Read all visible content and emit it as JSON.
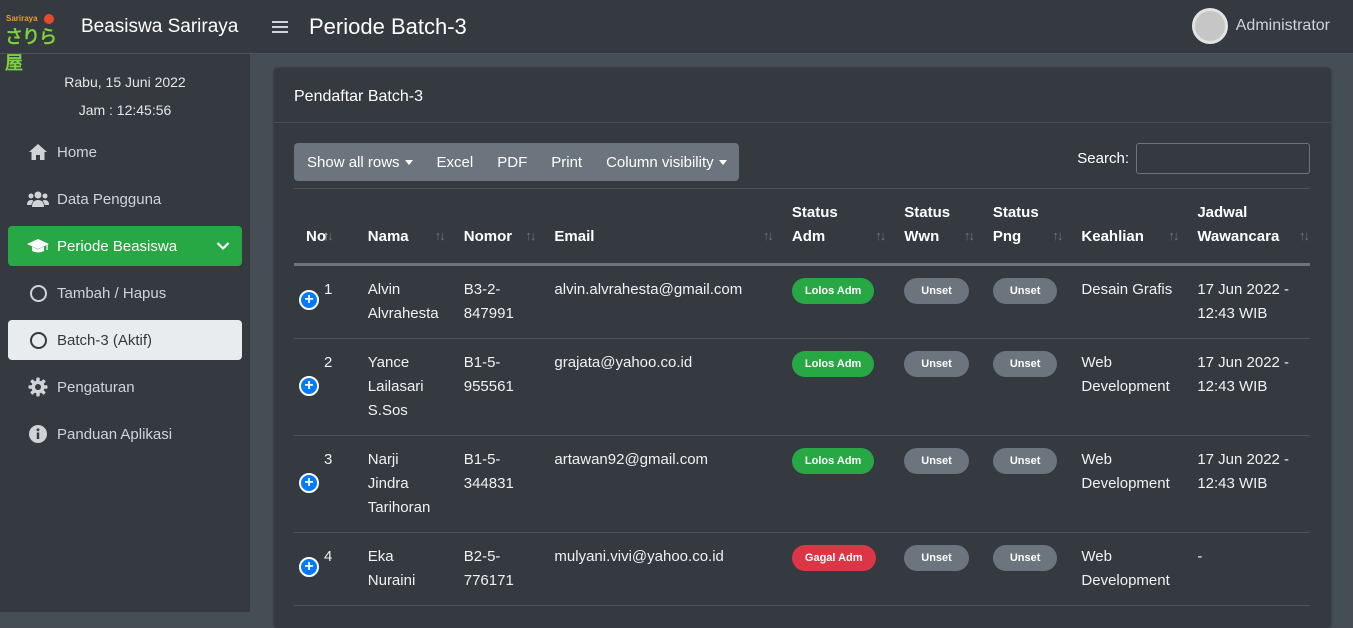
{
  "brand": {
    "logo_small": "Sariraya",
    "logo_big": "さりら屋",
    "name": "Beasiswa Sariraya"
  },
  "datetime": {
    "date": "Rabu, 15 Juni 2022",
    "time": "Jam : 12:45:56"
  },
  "nav": {
    "home": "Home",
    "users": "Data Pengguna",
    "periode": "Periode Beasiswa",
    "tambah": "Tambah / Hapus",
    "batch": "Batch-3 (Aktif)",
    "pengaturan": "Pengaturan",
    "panduan": "Panduan Aplikasi"
  },
  "header": {
    "title": "Periode Batch-3",
    "user": "Administrator"
  },
  "card": {
    "title": "Pendaftar Batch-3"
  },
  "toolbar": {
    "show_rows": "Show all rows",
    "excel": "Excel",
    "pdf": "PDF",
    "print": "Print",
    "colvis": "Column visibility"
  },
  "search": {
    "label": "Search:",
    "value": ""
  },
  "table": {
    "headers": {
      "no": "No",
      "nama": "Nama",
      "nomor": "Nomor",
      "email": "Email",
      "sadm_1": "Status",
      "sadm_2": "Adm",
      "swwn_1": "Status",
      "swwn_2": "Wwn",
      "spng_1": "Status",
      "spng_2": "Png",
      "keahlian": "Keahlian",
      "jadwal_1": "Jadwal",
      "jadwal_2": "Wawancara"
    },
    "rows": [
      {
        "no": "1",
        "nama": [
          "Alvin",
          "Alvrahesta"
        ],
        "nomor": [
          "B3-2-",
          "847991"
        ],
        "email": "alvin.alvrahesta@gmail.com",
        "adm": "Lolos Adm",
        "wwn": "Unset",
        "png": "Unset",
        "keahlian": [
          "Desain Grafis"
        ],
        "jadwal": [
          "17 Jun 2022 -",
          "12:43 WIB"
        ]
      },
      {
        "no": "2",
        "nama": [
          "Yance",
          "Lailasari",
          "S.Sos"
        ],
        "nomor": [
          "B1-5-",
          "955561"
        ],
        "email": "grajata@yahoo.co.id",
        "adm": "Lolos Adm",
        "wwn": "Unset",
        "png": "Unset",
        "keahlian": [
          "Web",
          "Development"
        ],
        "jadwal": [
          "17 Jun 2022 -",
          "12:43 WIB"
        ]
      },
      {
        "no": "3",
        "nama": [
          "Narji",
          "Jindra",
          "Tarihoran"
        ],
        "nomor": [
          "B1-5-",
          "344831"
        ],
        "email": "artawan92@gmail.com",
        "adm": "Lolos Adm",
        "wwn": "Unset",
        "png": "Unset",
        "keahlian": [
          "Web",
          "Development"
        ],
        "jadwal": [
          "17 Jun 2022 -",
          "12:43 WIB"
        ]
      },
      {
        "no": "4",
        "nama": [
          "Eka",
          "Nuraini"
        ],
        "nomor": [
          "B2-5-",
          "776171"
        ],
        "email": "mulyani.vivi@yahoo.co.id",
        "adm": "Gagal Adm",
        "wwn": "Unset",
        "png": "Unset",
        "keahlian": [
          "Web",
          "Development"
        ],
        "jadwal": [
          "-"
        ]
      }
    ]
  },
  "colors": {
    "green": "#28a745",
    "red": "#dc3545",
    "gray": "#6c757d",
    "blue": "#007bff",
    "dark": "#343a40"
  }
}
